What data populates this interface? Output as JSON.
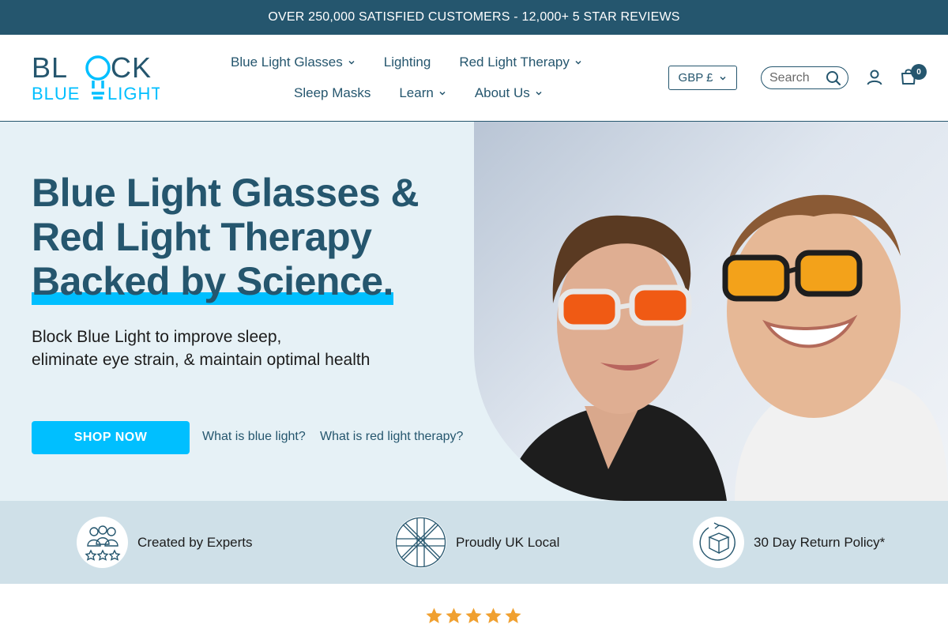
{
  "announcement": "OVER 250,000 SATISFIED CUSTOMERS - 12,000+ 5 STAR REVIEWS",
  "logo": {
    "line1": "BLOCK",
    "line2": "BLUE LIGHT"
  },
  "nav": {
    "row1": [
      {
        "label": "Blue Light Glasses",
        "dropdown": true
      },
      {
        "label": "Lighting",
        "dropdown": false
      },
      {
        "label": "Red Light Therapy",
        "dropdown": true
      }
    ],
    "row2": [
      {
        "label": "Sleep Masks",
        "dropdown": false
      },
      {
        "label": "Learn",
        "dropdown": true
      },
      {
        "label": "About Us",
        "dropdown": true
      }
    ]
  },
  "currency": {
    "selected": "GBP £"
  },
  "search": {
    "placeholder": "Search"
  },
  "cart": {
    "count": "0"
  },
  "hero": {
    "title_line1": "Blue Light Glasses &",
    "title_line2": "Red Light Therapy",
    "title_line3": "Backed by Science.",
    "subtitle_line1": "Block Blue Light to improve sleep,",
    "subtitle_line2": "eliminate eye strain, & maintain optimal health",
    "cta_label": "SHOP NOW",
    "link1": "What is blue light?",
    "link2": "What is red light therapy?"
  },
  "features": [
    {
      "label": "Created by Experts",
      "icon": "experts-icon"
    },
    {
      "label": "Proudly UK Local",
      "icon": "uk-flag-icon"
    },
    {
      "label": "30 Day Return Policy*",
      "icon": "return-box-icon"
    }
  ],
  "reviews": {
    "stars": 5
  },
  "colors": {
    "brand_navy": "#25566e",
    "accent_cyan": "#00bfff",
    "hero_bg": "#e6f1f6",
    "features_bg": "#cfe0e8",
    "star": "#f0a030"
  }
}
